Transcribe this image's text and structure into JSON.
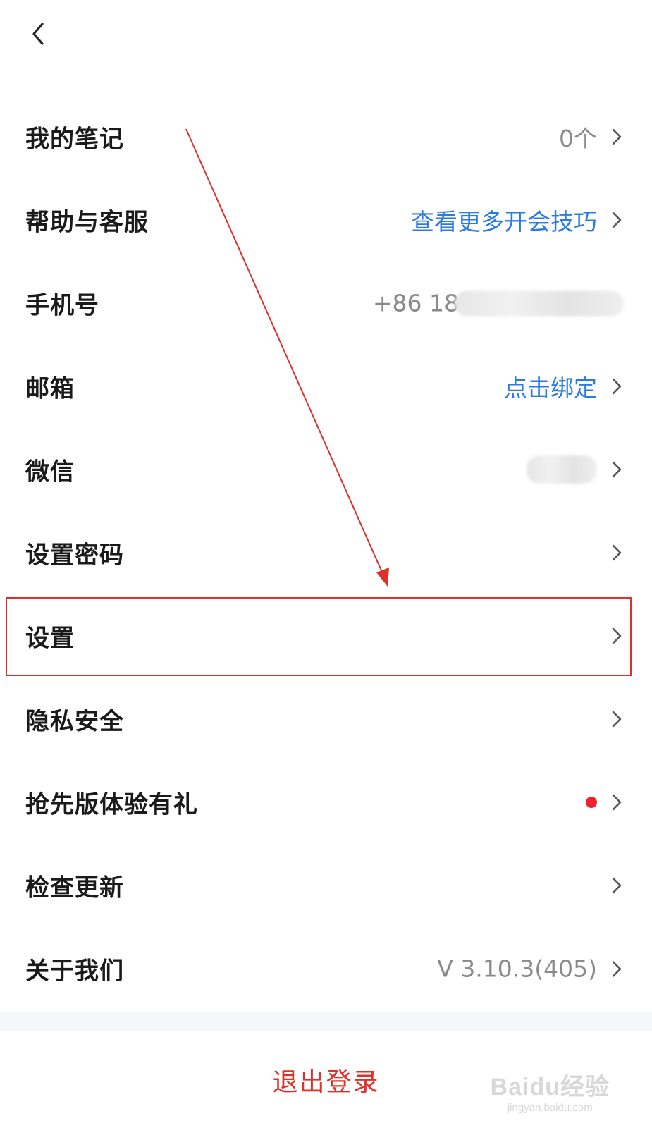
{
  "colors": {
    "accent": "#2b7be4",
    "danger": "#e0302a",
    "text": "#1a1a1a",
    "muted": "#8a8a8a",
    "badge": "#f0232d"
  },
  "header": {
    "back_icon": "chevron-left-icon"
  },
  "rows": [
    {
      "key": "notes",
      "label": "我的笔记",
      "value": "0个",
      "value_style": "muted"
    },
    {
      "key": "help",
      "label": "帮助与客服",
      "value": "查看更多开会技巧",
      "value_style": "blue"
    },
    {
      "key": "phone",
      "label": "手机号",
      "value": "+86 18",
      "value_style": "muted",
      "redacted": true
    },
    {
      "key": "email",
      "label": "邮箱",
      "value": "点击绑定",
      "value_style": "blue"
    },
    {
      "key": "wechat",
      "label": "微信",
      "value": "",
      "value_style": "muted",
      "redacted": true
    },
    {
      "key": "password",
      "label": "设置密码",
      "value": ""
    },
    {
      "key": "settings",
      "label": "设置",
      "value": "",
      "highlighted": true
    },
    {
      "key": "privacy",
      "label": "隐私安全",
      "value": ""
    },
    {
      "key": "beta",
      "label": "抢先版体验有礼",
      "value": "",
      "badge": "red-dot"
    },
    {
      "key": "update",
      "label": "检查更新",
      "value": ""
    },
    {
      "key": "about",
      "label": "关于我们",
      "value": "V 3.10.3(405)",
      "value_style": "muted"
    }
  ],
  "logout_label": "退出登录",
  "watermark": {
    "main": "Baidu经验",
    "sub": "jingyan.baidu.com"
  }
}
